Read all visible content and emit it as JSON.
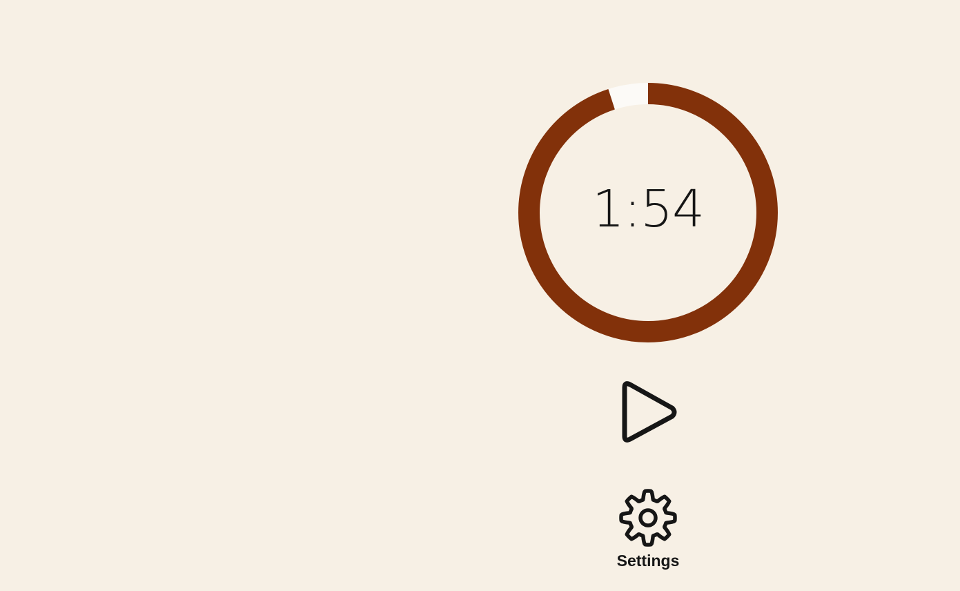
{
  "timer": {
    "time_display": "1:54",
    "progress_remaining": 0.95,
    "progress_color": "#82310a",
    "track_color": "#fcfaf7"
  },
  "controls": {
    "play_icon": "play-icon",
    "settings_icon": "gear-icon",
    "settings_label": "Settings"
  },
  "colors": {
    "background": "#f7f0e5",
    "foreground": "#161616"
  }
}
